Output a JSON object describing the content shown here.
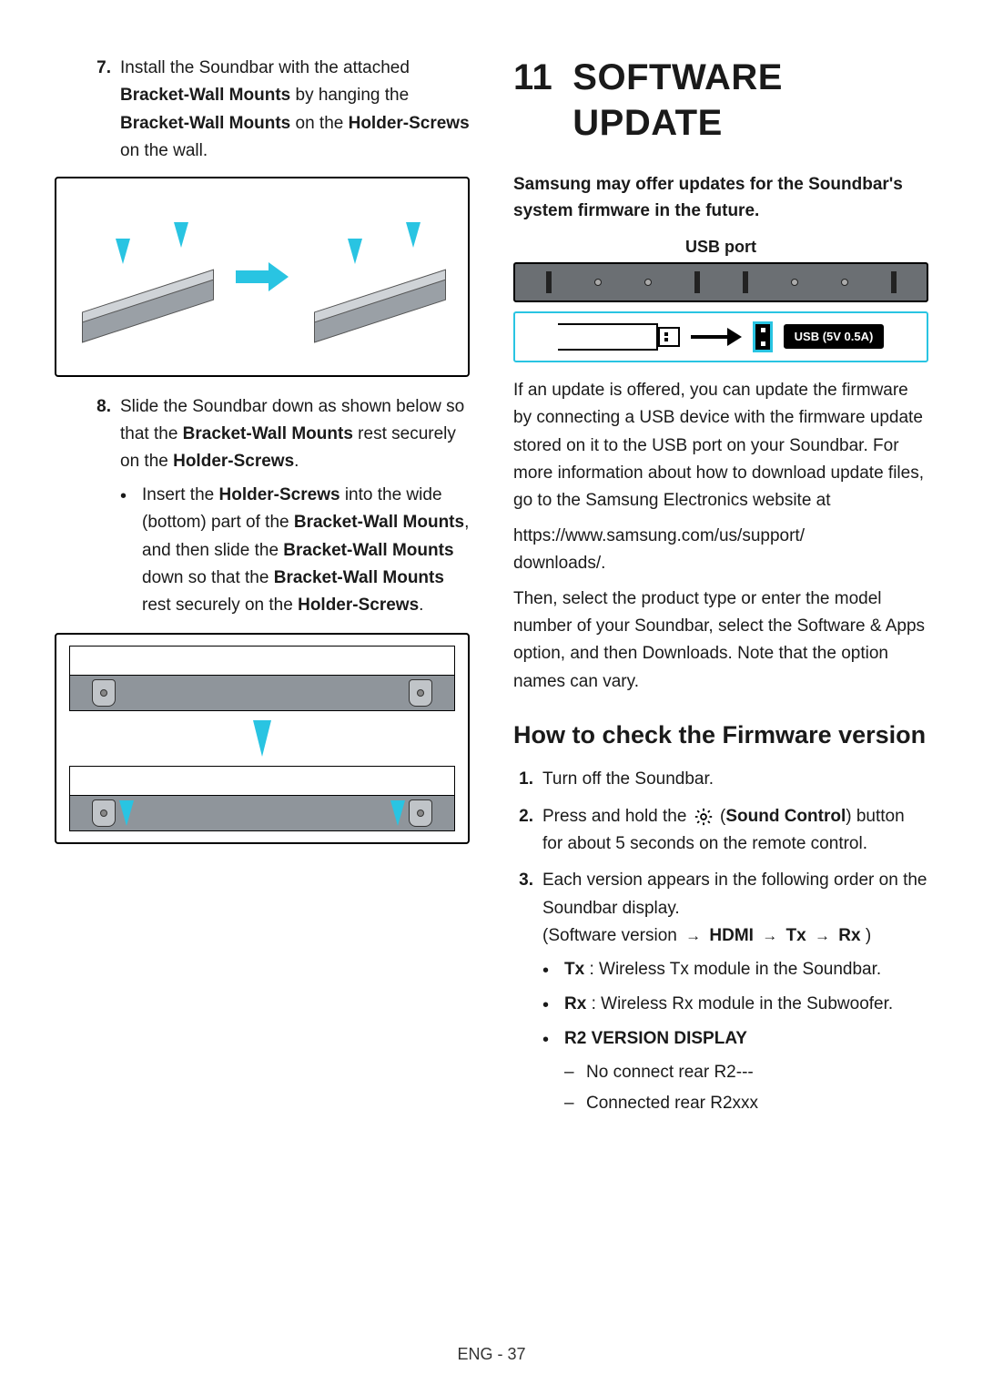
{
  "left": {
    "item7": {
      "num": "7.",
      "t1": "Install the Soundbar with the attached ",
      "b1": "Bracket-Wall Mounts",
      "t2": " by hanging the ",
      "b2": "Bracket-Wall Mounts",
      "t3": " on the ",
      "b3": "Holder-Screws",
      "t4": " on the wall."
    },
    "item8": {
      "num": "8.",
      "t1": "Slide the Soundbar down as shown below so that the ",
      "b1": "Bracket-Wall Mounts",
      "t2": " rest securely on the ",
      "b2": "Holder-Screws",
      "t3": "."
    },
    "sub8": {
      "t1": "Insert the ",
      "b1": "Holder-Screws",
      "t2": " into the wide (bottom) part of the ",
      "b2": "Bracket-Wall Mounts",
      "t3": ", and then slide the ",
      "b3": "Bracket-Wall Mounts",
      "t4": " down so that the ",
      "b4": "Bracket-Wall Mounts",
      "t5": " rest securely on the ",
      "b5": "Holder-Screws",
      "t6": "."
    }
  },
  "right": {
    "secnum": "11",
    "title": "SOFTWARE UPDATE",
    "lead": "Samsung may offer updates for the Soundbar's system firmware in the future.",
    "usb_label": "USB port",
    "usb_tag": "USB (5V 0.5A)",
    "para1": "If an update is offered, you can update the firmware by connecting a USB device with the firmware update stored on it to the USB port on your Soundbar. For more information about how to download update files, go to the Samsung Electronics website at",
    "url1": "https://www.samsung.com/us/support/",
    "url2": "downloads/.",
    "para2": "Then, select the product type or enter the model number of your Soundbar, select the Software & Apps option, and then Downloads. Note that the option names can vary.",
    "h2": "How to check the Firmware version",
    "fw1": {
      "num": "1.",
      "text": "Turn off the Soundbar."
    },
    "fw2": {
      "num": "2.",
      "t1": "Press and hold the ",
      "b1": "Sound Control",
      "t2": " button for about 5 seconds on the remote control."
    },
    "fw3": {
      "num": "3.",
      "t1": "Each version appears in the following order on the Soundbar display.",
      "seq_pre": "(Software version ",
      "seq_hdmi": "HDMI",
      "seq_tx": "Tx",
      "seq_rx": "Rx",
      "seq_close": " )"
    },
    "b_tx": {
      "b": "Tx",
      "t": " : Wireless Tx module in the Soundbar."
    },
    "b_rx": {
      "b": "Rx",
      "t": " : Wireless Rx module in the Subwoofer."
    },
    "b_r2": "R2 VERSION DISPLAY",
    "d_r2a": "No connect rear R2---",
    "d_r2b": "Connected rear R2xxx"
  },
  "footer": "ENG - 37",
  "arrow_char": "→"
}
